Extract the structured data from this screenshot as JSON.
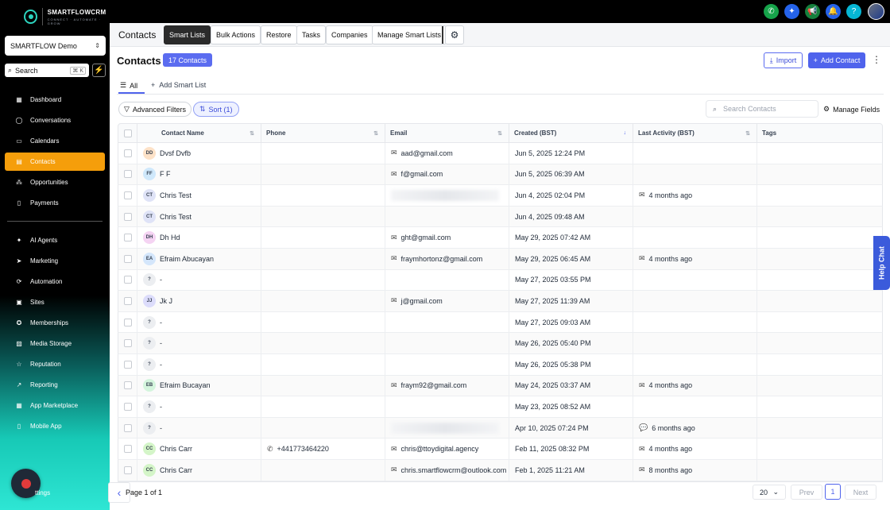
{
  "brand": {
    "name": "SMARTFLOWCRM",
    "tagline": "CONNECT · AUTOMATE · GROW"
  },
  "account": {
    "name": "SMARTFLOW Demo"
  },
  "search": {
    "label": "Search",
    "shortcut": "⌘ K"
  },
  "sidebar": {
    "items": [
      {
        "label": "Dashboard",
        "icon": "dashboard-icon"
      },
      {
        "label": "Conversations",
        "icon": "chat-icon"
      },
      {
        "label": "Calendars",
        "icon": "calendar-icon"
      },
      {
        "label": "Contacts",
        "icon": "contacts-icon",
        "active": true
      },
      {
        "label": "Opportunities",
        "icon": "opportunities-icon"
      },
      {
        "label": "Payments",
        "icon": "payments-icon"
      }
    ],
    "items2": [
      {
        "label": "AI Agents",
        "icon": "sparkle-icon"
      },
      {
        "label": "Marketing",
        "icon": "send-icon"
      },
      {
        "label": "Automation",
        "icon": "automation-icon"
      },
      {
        "label": "Sites",
        "icon": "sites-icon"
      },
      {
        "label": "Memberships",
        "icon": "award-icon"
      },
      {
        "label": "Media Storage",
        "icon": "image-icon"
      },
      {
        "label": "Reputation",
        "icon": "star-icon"
      },
      {
        "label": "Reporting",
        "icon": "trend-icon"
      },
      {
        "label": "App Marketplace",
        "icon": "grid-icon"
      },
      {
        "label": "Mobile App",
        "icon": "mobile-icon"
      }
    ],
    "settings_label": "ttings"
  },
  "topbar": {
    "icons": [
      "phone-icon",
      "magic-icon",
      "megaphone-icon",
      "bell-icon",
      "help-icon"
    ],
    "colors": [
      "#16a34a",
      "#2563eb",
      "#15803d",
      "#2563eb",
      "#06b6d4"
    ]
  },
  "tabs": {
    "title": "Contacts",
    "items": [
      "Smart Lists",
      "Bulk Actions",
      "Restore",
      "Tasks",
      "Companies",
      "Manage Smart Lists"
    ]
  },
  "header": {
    "title": "Contacts",
    "count": "17 Contacts",
    "import_label": "Import",
    "add_label": "Add Contact"
  },
  "subtabs": {
    "all": "All",
    "add": "Add Smart List"
  },
  "filters": {
    "advanced": "Advanced Filters",
    "sort": "Sort (1)",
    "search_placeholder": "Search Contacts",
    "manage_fields": "Manage Fields"
  },
  "table": {
    "columns": [
      "Contact Name",
      "Phone",
      "Email",
      "Created (BST)",
      "Last Activity (BST)",
      "Tags"
    ],
    "rows": [
      {
        "initials": "DD",
        "avbg": "#fde2c8",
        "name": "Dvsf Dvfb",
        "phone": "",
        "email": "aad@gmail.com",
        "created": "Jun 5, 2025 12:24 PM",
        "activity": "",
        "act_icon": ""
      },
      {
        "initials": "FF",
        "avbg": "#cfe8fb",
        "name": "F F",
        "phone": "",
        "email": "f@gmail.com",
        "created": "Jun 5, 2025 06:39 AM",
        "activity": "",
        "act_icon": ""
      },
      {
        "initials": "CT",
        "avbg": "#dfe3f7",
        "name": "Chris Test",
        "phone": "",
        "email": "",
        "email_blur": true,
        "created": "Jun 4, 2025 02:04 PM",
        "activity": "4 months ago",
        "act_icon": "✉"
      },
      {
        "initials": "CT",
        "avbg": "#dfe3f7",
        "name": "Chris Test",
        "phone": "",
        "email": "",
        "created": "Jun 4, 2025 09:48 AM",
        "activity": "",
        "act_icon": ""
      },
      {
        "initials": "DH",
        "avbg": "#f5d4f3",
        "name": "Dh Hd",
        "phone": "",
        "email": "ght@gmail.com",
        "created": "May 29, 2025 07:42 AM",
        "activity": "",
        "act_icon": ""
      },
      {
        "initials": "EA",
        "avbg": "#d4e6fb",
        "name": "Efraim Abucayan",
        "phone": "",
        "email": "fraymhortonz@gmail.com",
        "created": "May 29, 2025 06:45 AM",
        "activity": "4 months ago",
        "act_icon": "✉"
      },
      {
        "initials": "?",
        "avbg": "#eceef1",
        "name": "-",
        "phone": "",
        "email": "",
        "created": "May 27, 2025 03:55 PM",
        "activity": "",
        "act_icon": ""
      },
      {
        "initials": "JJ",
        "avbg": "#dcdcfb",
        "name": "Jk J",
        "phone": "",
        "email": "j@gmail.com",
        "created": "May 27, 2025 11:39 AM",
        "activity": "",
        "act_icon": ""
      },
      {
        "initials": "?",
        "avbg": "#eceef1",
        "name": "-",
        "phone": "",
        "email": "",
        "created": "May 27, 2025 09:03 AM",
        "activity": "",
        "act_icon": ""
      },
      {
        "initials": "?",
        "avbg": "#eceef1",
        "name": "-",
        "phone": "",
        "email": "",
        "created": "May 26, 2025 05:40 PM",
        "activity": "",
        "act_icon": ""
      },
      {
        "initials": "?",
        "avbg": "#eceef1",
        "name": "-",
        "phone": "",
        "email": "",
        "created": "May 26, 2025 05:38 PM",
        "activity": "",
        "act_icon": ""
      },
      {
        "initials": "EB",
        "avbg": "#d4f5dd",
        "name": "Efraim Bucayan",
        "phone": "",
        "email": "fraym92@gmail.com",
        "created": "May 24, 2025 03:37 AM",
        "activity": "4 months ago",
        "act_icon": "✉"
      },
      {
        "initials": "?",
        "avbg": "#eceef1",
        "name": "-",
        "phone": "",
        "email": "",
        "created": "May 23, 2025 08:52 AM",
        "activity": "",
        "act_icon": ""
      },
      {
        "initials": "?",
        "avbg": "#eceef1",
        "name": "-",
        "phone": "",
        "email": "",
        "email_blur": true,
        "created": "Apr 10, 2025 07:24 PM",
        "activity": "6 months ago",
        "act_icon": "💬"
      },
      {
        "initials": "CC",
        "avbg": "#d4f5c8",
        "name": "Chris Carr",
        "phone": "+441773464220",
        "email": "chris@ttoydigital.agency",
        "created": "Feb 11, 2025 08:32 PM",
        "activity": "4 months ago",
        "act_icon": "✉"
      },
      {
        "initials": "CC",
        "avbg": "#d4f5c8",
        "name": "Chris Carr",
        "phone": "",
        "email": "chris.smartflowcrm@outlook.com",
        "created": "Feb 1, 2025 11:21 AM",
        "activity": "8 months ago",
        "act_icon": "✉"
      }
    ]
  },
  "pager": {
    "text": "Page 1 of 1",
    "per_page": "20",
    "prev": "Prev",
    "page": "1",
    "next": "Next"
  },
  "help_chat": "Help Chat"
}
